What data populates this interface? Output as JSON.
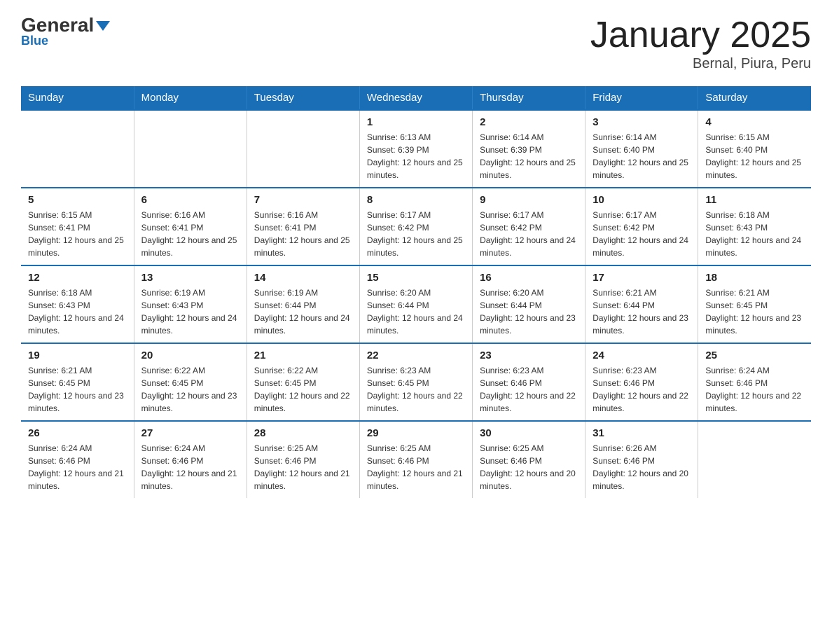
{
  "logo": {
    "general": "General",
    "blue": "Blue",
    "underline": "Blue"
  },
  "header": {
    "title": "January 2025",
    "subtitle": "Bernal, Piura, Peru"
  },
  "days_of_week": [
    "Sunday",
    "Monday",
    "Tuesday",
    "Wednesday",
    "Thursday",
    "Friday",
    "Saturday"
  ],
  "weeks": [
    [
      {
        "day": "",
        "sunrise": "",
        "sunset": "",
        "daylight": ""
      },
      {
        "day": "",
        "sunrise": "",
        "sunset": "",
        "daylight": ""
      },
      {
        "day": "",
        "sunrise": "",
        "sunset": "",
        "daylight": ""
      },
      {
        "day": "1",
        "sunrise": "Sunrise: 6:13 AM",
        "sunset": "Sunset: 6:39 PM",
        "daylight": "Daylight: 12 hours and 25 minutes."
      },
      {
        "day": "2",
        "sunrise": "Sunrise: 6:14 AM",
        "sunset": "Sunset: 6:39 PM",
        "daylight": "Daylight: 12 hours and 25 minutes."
      },
      {
        "day": "3",
        "sunrise": "Sunrise: 6:14 AM",
        "sunset": "Sunset: 6:40 PM",
        "daylight": "Daylight: 12 hours and 25 minutes."
      },
      {
        "day": "4",
        "sunrise": "Sunrise: 6:15 AM",
        "sunset": "Sunset: 6:40 PM",
        "daylight": "Daylight: 12 hours and 25 minutes."
      }
    ],
    [
      {
        "day": "5",
        "sunrise": "Sunrise: 6:15 AM",
        "sunset": "Sunset: 6:41 PM",
        "daylight": "Daylight: 12 hours and 25 minutes."
      },
      {
        "day": "6",
        "sunrise": "Sunrise: 6:16 AM",
        "sunset": "Sunset: 6:41 PM",
        "daylight": "Daylight: 12 hours and 25 minutes."
      },
      {
        "day": "7",
        "sunrise": "Sunrise: 6:16 AM",
        "sunset": "Sunset: 6:41 PM",
        "daylight": "Daylight: 12 hours and 25 minutes."
      },
      {
        "day": "8",
        "sunrise": "Sunrise: 6:17 AM",
        "sunset": "Sunset: 6:42 PM",
        "daylight": "Daylight: 12 hours and 25 minutes."
      },
      {
        "day": "9",
        "sunrise": "Sunrise: 6:17 AM",
        "sunset": "Sunset: 6:42 PM",
        "daylight": "Daylight: 12 hours and 24 minutes."
      },
      {
        "day": "10",
        "sunrise": "Sunrise: 6:17 AM",
        "sunset": "Sunset: 6:42 PM",
        "daylight": "Daylight: 12 hours and 24 minutes."
      },
      {
        "day": "11",
        "sunrise": "Sunrise: 6:18 AM",
        "sunset": "Sunset: 6:43 PM",
        "daylight": "Daylight: 12 hours and 24 minutes."
      }
    ],
    [
      {
        "day": "12",
        "sunrise": "Sunrise: 6:18 AM",
        "sunset": "Sunset: 6:43 PM",
        "daylight": "Daylight: 12 hours and 24 minutes."
      },
      {
        "day": "13",
        "sunrise": "Sunrise: 6:19 AM",
        "sunset": "Sunset: 6:43 PM",
        "daylight": "Daylight: 12 hours and 24 minutes."
      },
      {
        "day": "14",
        "sunrise": "Sunrise: 6:19 AM",
        "sunset": "Sunset: 6:44 PM",
        "daylight": "Daylight: 12 hours and 24 minutes."
      },
      {
        "day": "15",
        "sunrise": "Sunrise: 6:20 AM",
        "sunset": "Sunset: 6:44 PM",
        "daylight": "Daylight: 12 hours and 24 minutes."
      },
      {
        "day": "16",
        "sunrise": "Sunrise: 6:20 AM",
        "sunset": "Sunset: 6:44 PM",
        "daylight": "Daylight: 12 hours and 23 minutes."
      },
      {
        "day": "17",
        "sunrise": "Sunrise: 6:21 AM",
        "sunset": "Sunset: 6:44 PM",
        "daylight": "Daylight: 12 hours and 23 minutes."
      },
      {
        "day": "18",
        "sunrise": "Sunrise: 6:21 AM",
        "sunset": "Sunset: 6:45 PM",
        "daylight": "Daylight: 12 hours and 23 minutes."
      }
    ],
    [
      {
        "day": "19",
        "sunrise": "Sunrise: 6:21 AM",
        "sunset": "Sunset: 6:45 PM",
        "daylight": "Daylight: 12 hours and 23 minutes."
      },
      {
        "day": "20",
        "sunrise": "Sunrise: 6:22 AM",
        "sunset": "Sunset: 6:45 PM",
        "daylight": "Daylight: 12 hours and 23 minutes."
      },
      {
        "day": "21",
        "sunrise": "Sunrise: 6:22 AM",
        "sunset": "Sunset: 6:45 PM",
        "daylight": "Daylight: 12 hours and 22 minutes."
      },
      {
        "day": "22",
        "sunrise": "Sunrise: 6:23 AM",
        "sunset": "Sunset: 6:45 PM",
        "daylight": "Daylight: 12 hours and 22 minutes."
      },
      {
        "day": "23",
        "sunrise": "Sunrise: 6:23 AM",
        "sunset": "Sunset: 6:46 PM",
        "daylight": "Daylight: 12 hours and 22 minutes."
      },
      {
        "day": "24",
        "sunrise": "Sunrise: 6:23 AM",
        "sunset": "Sunset: 6:46 PM",
        "daylight": "Daylight: 12 hours and 22 minutes."
      },
      {
        "day": "25",
        "sunrise": "Sunrise: 6:24 AM",
        "sunset": "Sunset: 6:46 PM",
        "daylight": "Daylight: 12 hours and 22 minutes."
      }
    ],
    [
      {
        "day": "26",
        "sunrise": "Sunrise: 6:24 AM",
        "sunset": "Sunset: 6:46 PM",
        "daylight": "Daylight: 12 hours and 21 minutes."
      },
      {
        "day": "27",
        "sunrise": "Sunrise: 6:24 AM",
        "sunset": "Sunset: 6:46 PM",
        "daylight": "Daylight: 12 hours and 21 minutes."
      },
      {
        "day": "28",
        "sunrise": "Sunrise: 6:25 AM",
        "sunset": "Sunset: 6:46 PM",
        "daylight": "Daylight: 12 hours and 21 minutes."
      },
      {
        "day": "29",
        "sunrise": "Sunrise: 6:25 AM",
        "sunset": "Sunset: 6:46 PM",
        "daylight": "Daylight: 12 hours and 21 minutes."
      },
      {
        "day": "30",
        "sunrise": "Sunrise: 6:25 AM",
        "sunset": "Sunset: 6:46 PM",
        "daylight": "Daylight: 12 hours and 20 minutes."
      },
      {
        "day": "31",
        "sunrise": "Sunrise: 6:26 AM",
        "sunset": "Sunset: 6:46 PM",
        "daylight": "Daylight: 12 hours and 20 minutes."
      },
      {
        "day": "",
        "sunrise": "",
        "sunset": "",
        "daylight": ""
      }
    ]
  ]
}
